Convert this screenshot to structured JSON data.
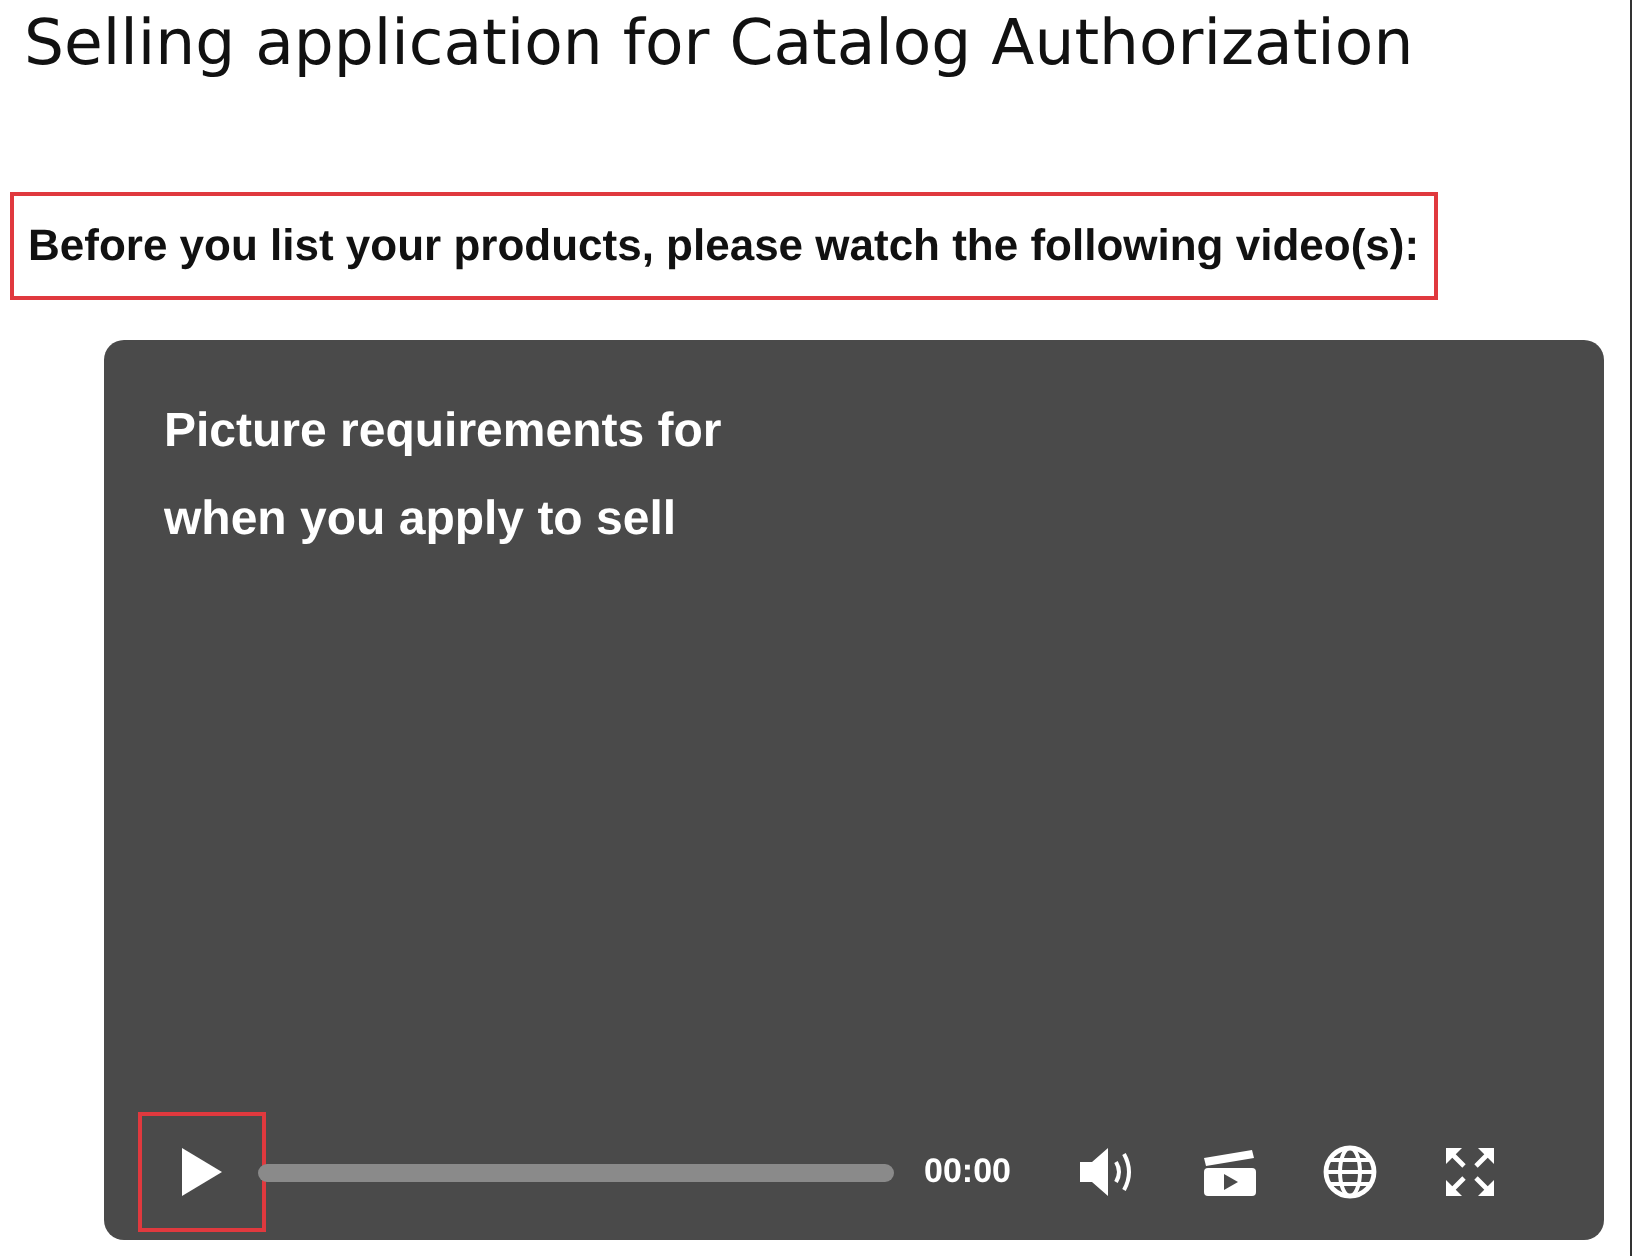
{
  "page": {
    "title": "Selling application for Catalog Authorization"
  },
  "instruction": {
    "text": "Before you list your products, please watch the following video(s):",
    "highlighted": true
  },
  "video": {
    "title": "Picture requirements for when you apply to sell",
    "play_highlighted": true,
    "time": "00:00"
  }
}
